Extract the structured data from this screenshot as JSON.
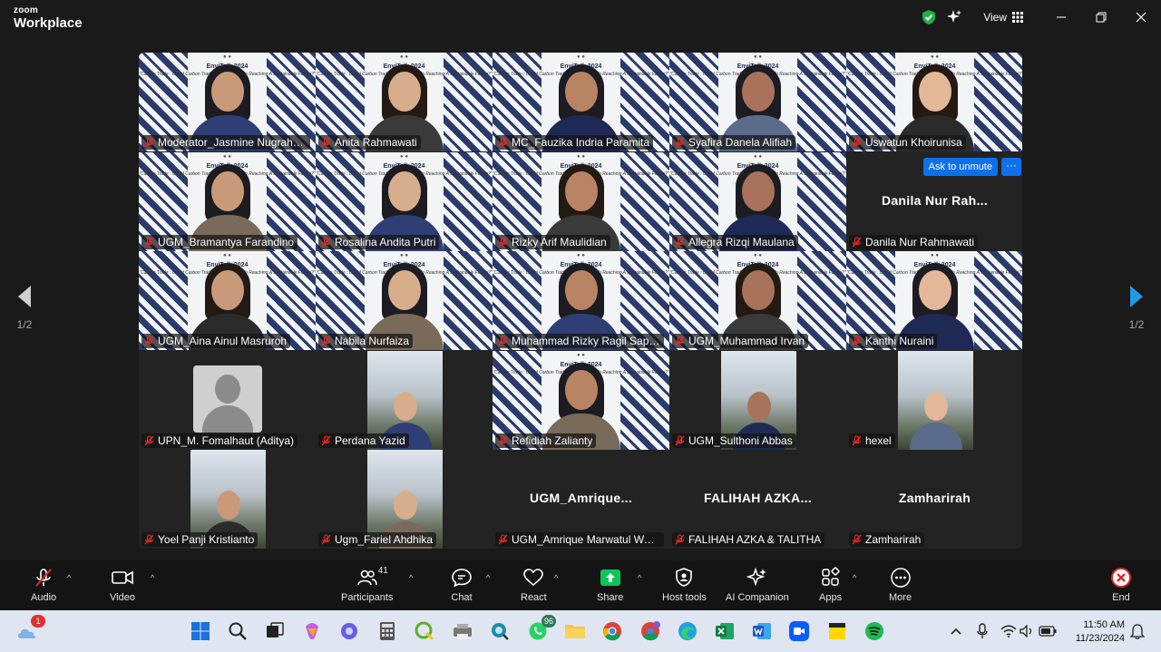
{
  "app": {
    "brand_top": "zoom",
    "brand_bottom": "Workplace"
  },
  "titlebar": {
    "view_label": "View"
  },
  "pager": {
    "left": "1/2",
    "right": "1/2"
  },
  "participants": [
    {
      "name": "Moderator_Jasmine Nugraheni",
      "type": "camera"
    },
    {
      "name": "Anita Rahmawati",
      "type": "camera"
    },
    {
      "name": "MC_Fauzika Indria Paramita",
      "type": "camera",
      "active": true
    },
    {
      "name": "Syafira Danela Alifiah",
      "type": "camera"
    },
    {
      "name": "Uswatun Khoirunisa",
      "type": "camera"
    },
    {
      "name": "UGM_Bramantya Farandino",
      "type": "camera"
    },
    {
      "name": "Rosalina Andita Putri",
      "type": "camera"
    },
    {
      "name": "Rizky Arif Maulidian",
      "type": "camera"
    },
    {
      "name": "Allegra Rizqi Maulana",
      "type": "camera"
    },
    {
      "name": "Danila Nur Rahmawati",
      "type": "name",
      "display": "Danila Nur Rah..."
    },
    {
      "name": "UGM_Aina Ainul Masruroh",
      "type": "camera"
    },
    {
      "name": "Nabila Nurfaiza",
      "type": "camera"
    },
    {
      "name": "Muhammad Rizky Ragil Saput...",
      "type": "camera"
    },
    {
      "name": "UGM_Muhammad Irvan",
      "type": "camera"
    },
    {
      "name": "Kanthi Nuraini",
      "type": "camera"
    },
    {
      "name": "UPN_M. Fomalhaut (Aditya)",
      "type": "avatar"
    },
    {
      "name": "Perdana Yazid",
      "type": "portrait"
    },
    {
      "name": "Refidiah Zalianty",
      "type": "camera"
    },
    {
      "name": "UGM_Sulthoni Abbas",
      "type": "portrait"
    },
    {
      "name": "hexel",
      "type": "portrait"
    },
    {
      "name": "Yoel Panji Kristianto",
      "type": "portrait"
    },
    {
      "name": "Ugm_Fariel Ahdhika",
      "type": "portrait"
    },
    {
      "name": "UGM_Amrique Marwatul Wafi...",
      "type": "name",
      "display": "UGM_Amrique..."
    },
    {
      "name": "FALIHAH AZKA & TALITHA",
      "type": "name",
      "display": "FALIHAH AZKA..."
    },
    {
      "name": "Zamharirah",
      "type": "name",
      "display": "Zamharirah"
    }
  ],
  "slide": {
    "title": "EnviTalk 2024",
    "subtitle": "\"Carbon Trade : Could Carbon Trading Be The Key To Reaching A Sustainable Future?\""
  },
  "unmute_label": "Ask to unmute",
  "toolbar": {
    "audio": "Audio",
    "video": "Video",
    "participants": "Participants",
    "participants_count": "41",
    "chat": "Chat",
    "react": "React",
    "share": "Share",
    "host_tools": "Host tools",
    "ai_companion": "AI Companion",
    "apps": "Apps",
    "more": "More",
    "end": "End"
  },
  "taskbar": {
    "notif_badge": "1",
    "whatsapp_badge": "96",
    "time": "11:50 AM",
    "date": "11/23/2024"
  },
  "colors": {
    "active_border": "#3ee36f",
    "unmute_blue": "#0e71eb",
    "end_red": "#e02828",
    "share_green": "#0ec55a"
  }
}
